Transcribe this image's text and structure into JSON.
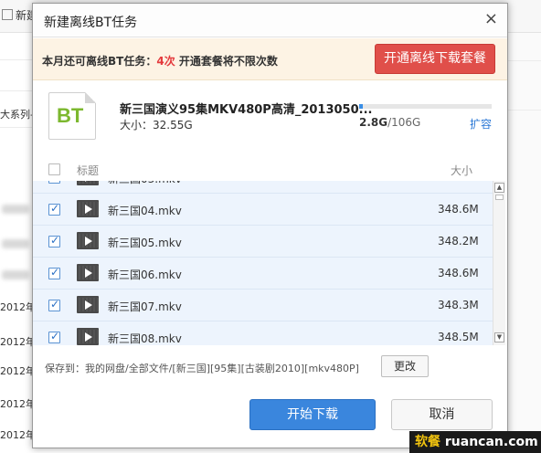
{
  "background": {
    "new_button_label": "新建",
    "row_texts": [
      "大系列-言",
      "2012年第",
      "2012年第",
      "2012年第",
      "2012年第",
      "2012年第"
    ]
  },
  "dialog": {
    "title": "新建离线BT任务",
    "close_glyph": "×",
    "notice": {
      "prefix": "本月还可离线BT任务：",
      "count": "4次",
      "suffix": "开通套餐将不限次数",
      "upgrade_label": "开通离线下载套餐"
    },
    "file": {
      "icon_text": "BT",
      "name": "新三国演义95集MKV480P高清_2013050...",
      "size": "大小：32.55G"
    },
    "quota": {
      "used": "2.8G",
      "total": "/106G",
      "used_fraction": 0.026,
      "expand_label": "扩容"
    },
    "list": {
      "header_title": "标题",
      "header_size": "大小",
      "rows": [
        {
          "name": "新三国03.mkv",
          "size": "348.6M",
          "checked": true
        },
        {
          "name": "新三国04.mkv",
          "size": "348.6M",
          "checked": true
        },
        {
          "name": "新三国05.mkv",
          "size": "348.2M",
          "checked": true
        },
        {
          "name": "新三国06.mkv",
          "size": "348.6M",
          "checked": true
        },
        {
          "name": "新三国07.mkv",
          "size": "348.3M",
          "checked": true
        },
        {
          "name": "新三国08.mkv",
          "size": "348.5M",
          "checked": true
        }
      ]
    },
    "save": {
      "label": "保存到：",
      "path": "我的网盘/全部文件/[新三国][95集][古装剧2010][mkv480P]",
      "change_label": "更改"
    },
    "start_label": "开始下载",
    "cancel_label": "取消"
  },
  "watermark": {
    "brand": "软餐",
    "domain": "ruancan.com"
  },
  "colors": {
    "accent_blue": "#3a86dd",
    "upgrade_red": "#e04f4a",
    "notice_bg": "#fdf3e4",
    "bt_green": "#7cb82f"
  }
}
